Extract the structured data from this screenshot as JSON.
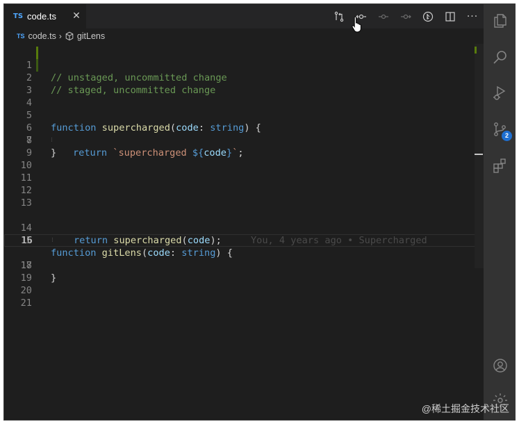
{
  "tab": {
    "lang": "TS",
    "title": "code.ts",
    "close": "✕"
  },
  "toolbar": {
    "buttons": [
      {
        "name": "open-changes-icon"
      },
      {
        "name": "previous-change-icon"
      },
      {
        "name": "next-commit-icon"
      },
      {
        "name": "forward-commit-icon"
      },
      {
        "name": "toggle-blame-icon"
      },
      {
        "name": "split-editor-icon"
      },
      {
        "name": "more-actions-icon"
      }
    ],
    "more_label": "···"
  },
  "breadcrumb": {
    "lang": "TS",
    "file": "code.ts",
    "sep": "›",
    "symbol": "gitLens"
  },
  "editor": {
    "line_numbers": [
      "1",
      "2",
      "3",
      "4",
      "5",
      "6",
      "7",
      "8",
      "9",
      "10",
      "11",
      "12",
      "13",
      "14",
      "15",
      "16",
      "17",
      "18",
      "19",
      "20",
      "21"
    ],
    "active_line": "16",
    "lines": {
      "l1": "// unstaged, uncommitted change",
      "l2": "// staged, uncommitted change",
      "l5_kw": "function",
      "l5_fn": "supercharged",
      "l5_p1": "(",
      "l5_param": "code",
      "l5_p2": ": ",
      "l5_type": "string",
      "l5_p3": ") {",
      "l6_kw": "return",
      "l6_str1": "`supercharged ",
      "l6_tpl1": "${",
      "l6_var": "code",
      "l6_tpl2": "}",
      "l6_str2": "`",
      "l6_end": ";",
      "l7": "}",
      "l15_kw": "function",
      "l15_fn": "gitLens",
      "l15_p1": "(",
      "l15_param": "code",
      "l15_p2": ": ",
      "l15_type": "string",
      "l15_p3": ") {",
      "l16_kw": "return",
      "l16_fn": "supercharged",
      "l16_p1": "(",
      "l16_param": "code",
      "l16_p2": ");",
      "l16_blame": "You, 4 years ago • Supercharged",
      "l17": "}"
    }
  },
  "activity": {
    "items": [
      {
        "name": "explorer-icon"
      },
      {
        "name": "search-icon"
      },
      {
        "name": "run-debug-icon"
      },
      {
        "name": "source-control-icon",
        "badge": "2"
      },
      {
        "name": "extensions-icon"
      },
      {
        "name": "account-icon"
      },
      {
        "name": "settings-gear-icon"
      }
    ]
  },
  "colors": {
    "accent": "#1e6fd1",
    "added": "#587c0c",
    "background": "#1e1e1e"
  },
  "watermark": "@稀土掘金技术社区"
}
